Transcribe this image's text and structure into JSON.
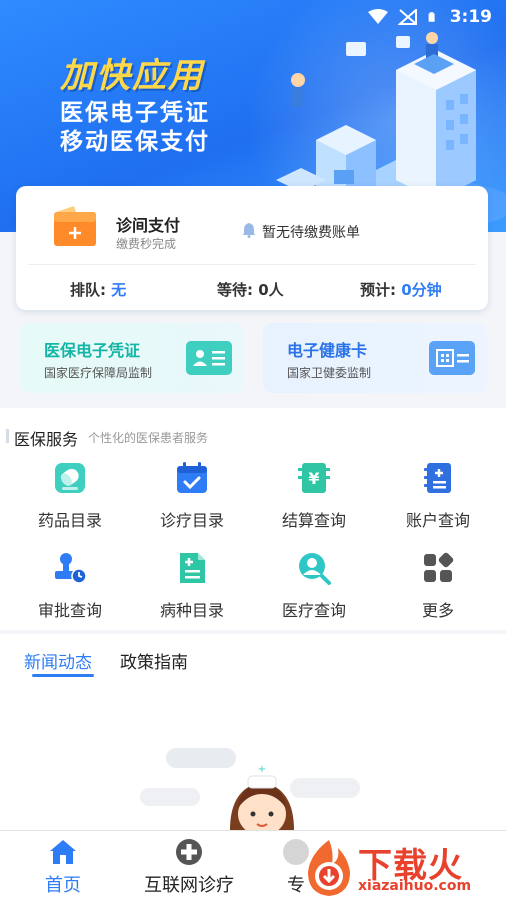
{
  "status_bar": {
    "time": "3:19"
  },
  "banner": {
    "headline": "加快应用",
    "line1": "医保电子凭证",
    "line2": "移动医保支付"
  },
  "payment": {
    "title": "诊间支付",
    "subtitle": "缴费秒完成",
    "bill_status": "暂无待缴费账单",
    "queue_label": "排队:",
    "queue_value": "无",
    "wait_label": "等待:",
    "wait_value": "0人",
    "estimate_label": "预计:",
    "estimate_value": "0分钟"
  },
  "cards": [
    {
      "title": "医保电子凭证",
      "subtitle": "国家医疗保障局监制"
    },
    {
      "title": "电子健康卡",
      "subtitle": "国家卫健委监制"
    }
  ],
  "services": {
    "title": "医保服务",
    "subtitle": "个性化的医保患者服务",
    "items": [
      {
        "label": "药品目录",
        "icon": "pill-icon"
      },
      {
        "label": "诊疗目录",
        "icon": "calendar-check-icon"
      },
      {
        "label": "结算查询",
        "icon": "yuan-receipt-icon"
      },
      {
        "label": "账户查询",
        "icon": "account-book-icon"
      },
      {
        "label": "审批查询",
        "icon": "stamp-clock-icon"
      },
      {
        "label": "病种目录",
        "icon": "document-plus-icon"
      },
      {
        "label": "医疗查询",
        "icon": "doctor-search-icon"
      },
      {
        "label": "更多",
        "icon": "grid-more-icon"
      }
    ]
  },
  "news": {
    "tabs": [
      "新闻动态",
      "政策指南"
    ],
    "active_tab": "新闻动态"
  },
  "bottom_nav": {
    "items": [
      {
        "label": "首页",
        "icon": "home-icon",
        "active": true
      },
      {
        "label": "互联网诊疗",
        "icon": "medical-cross-icon",
        "active": false
      },
      {
        "label": "专",
        "icon": "specialist-icon",
        "active": false
      }
    ]
  },
  "watermark": {
    "text": "下载火",
    "url": "xiazaihuo.com"
  },
  "colors": {
    "primary": "#2f7df6",
    "banner_blue": "#1f6ff0",
    "headline_yellow": "#ffd84a",
    "teal": "#12b5a6",
    "orange": "#ff8a2a",
    "watermark_red": "#e8412c"
  }
}
